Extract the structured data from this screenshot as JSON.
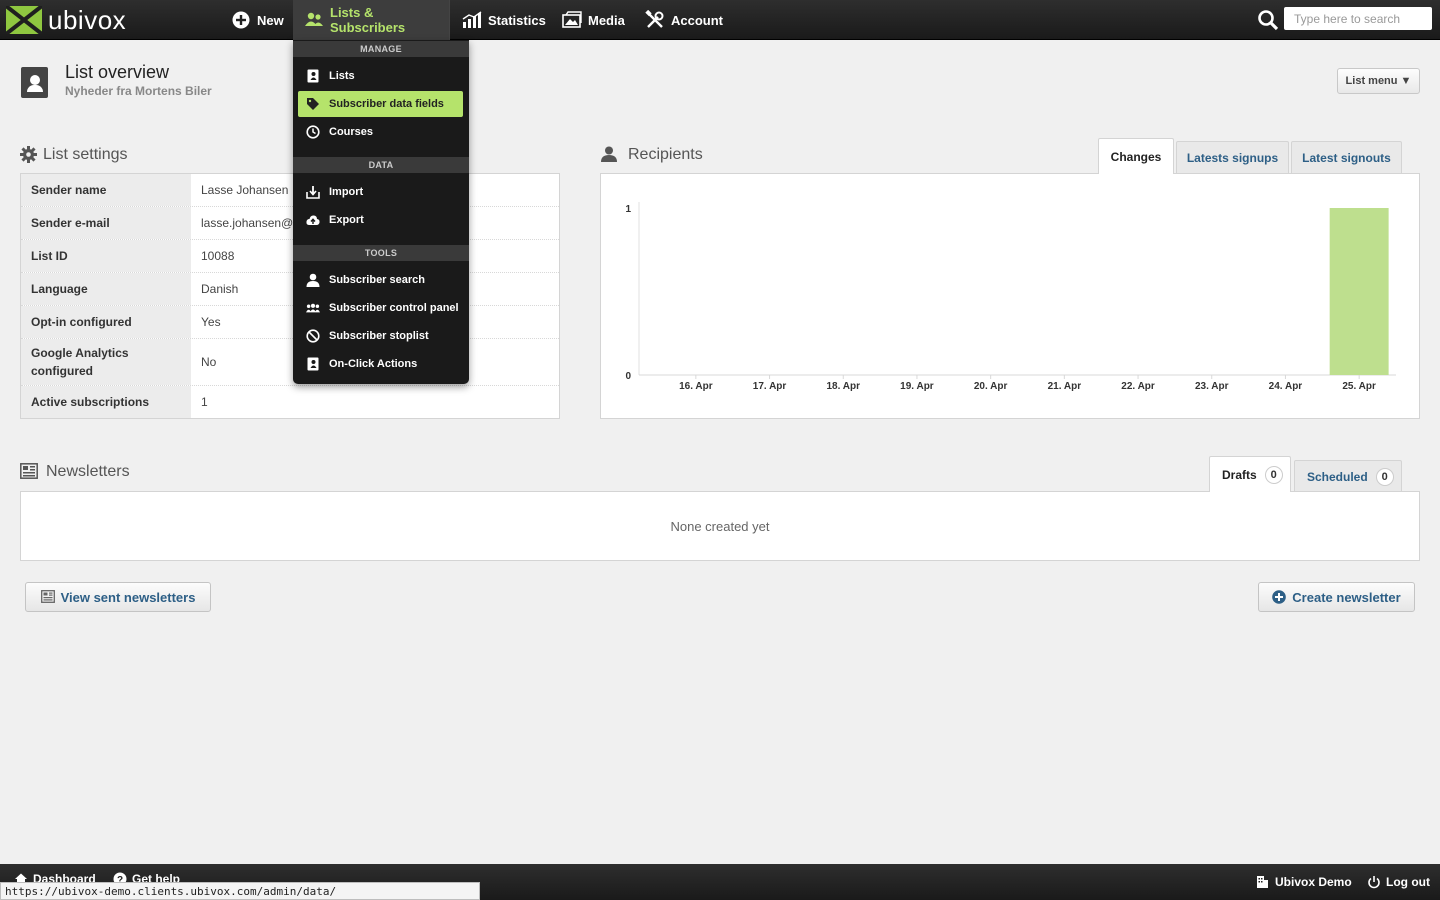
{
  "brand": {
    "name": "ubivox",
    "accent": "#b5e36b",
    "logo_green": "#8fc740"
  },
  "nav": {
    "new": "New",
    "lists": "Lists & Subscribers",
    "statistics": "Statistics",
    "media": "Media",
    "account": "Account",
    "search_placeholder": "Type here to search"
  },
  "header": {
    "title": "List overview",
    "subtitle": "Nyheder fra Mortens Biler",
    "list_menu": "List menu ▼"
  },
  "list_settings": {
    "title": "List settings",
    "rows": [
      {
        "key": "Sender name",
        "value": "Lasse Johansen"
      },
      {
        "key": "Sender e-mail",
        "value": "lasse.johansen@u"
      },
      {
        "key": "List ID",
        "value": "10088"
      },
      {
        "key": "Language",
        "value": "Danish"
      },
      {
        "key": "Opt-in configured",
        "value": "Yes"
      },
      {
        "key": "Google Analytics configured",
        "value": "No"
      },
      {
        "key": "Active subscriptions",
        "value": "1"
      }
    ]
  },
  "recipients": {
    "title": "Recipients",
    "tabs": [
      "Changes",
      "Latests signups",
      "Latest signouts"
    ],
    "active_tab": "Changes"
  },
  "chart_data": {
    "type": "bar",
    "categories": [
      "16. Apr",
      "17. Apr",
      "18. Apr",
      "19. Apr",
      "20. Apr",
      "21. Apr",
      "22. Apr",
      "23. Apr",
      "24. Apr",
      "25. Apr"
    ],
    "values": [
      0,
      0,
      0,
      0,
      0,
      0,
      0,
      0,
      0,
      1
    ],
    "ylim": [
      0,
      1
    ],
    "yticks": [
      "0",
      "1"
    ],
    "title": "",
    "xlabel": "",
    "ylabel": "",
    "bar_color": "#bedf8e"
  },
  "newsletters": {
    "title": "Newsletters",
    "tabs": [
      {
        "label": "Drafts",
        "count": "0"
      },
      {
        "label": "Scheduled",
        "count": "0"
      }
    ],
    "empty_text": "None created yet",
    "view_sent": "View sent newsletters",
    "create": "Create newsletter"
  },
  "dropdown": {
    "sections": [
      {
        "header": "MANAGE",
        "items": [
          {
            "label": "Lists",
            "icon": "book-icon"
          },
          {
            "label": "Subscriber data fields",
            "icon": "tag-icon",
            "highlight": true
          },
          {
            "label": "Courses",
            "icon": "clock-icon"
          }
        ]
      },
      {
        "header": "DATA",
        "items": [
          {
            "label": "Import",
            "icon": "import-icon"
          },
          {
            "label": "Export",
            "icon": "cloud-upload-icon"
          }
        ]
      },
      {
        "header": "TOOLS",
        "items": [
          {
            "label": "Subscriber search",
            "icon": "user-icon"
          },
          {
            "label": "Subscriber control panel",
            "icon": "users-icon"
          },
          {
            "label": "Subscriber stoplist",
            "icon": "ban-icon"
          },
          {
            "label": "On-Click Actions",
            "icon": "book-icon"
          }
        ]
      }
    ]
  },
  "footer": {
    "dashboard": "Dashboard",
    "help": "Get help",
    "account_name": "Ubivox Demo",
    "logout": "Log out",
    "status_url": "https://ubivox-demo.clients.ubivox.com/admin/data/"
  }
}
